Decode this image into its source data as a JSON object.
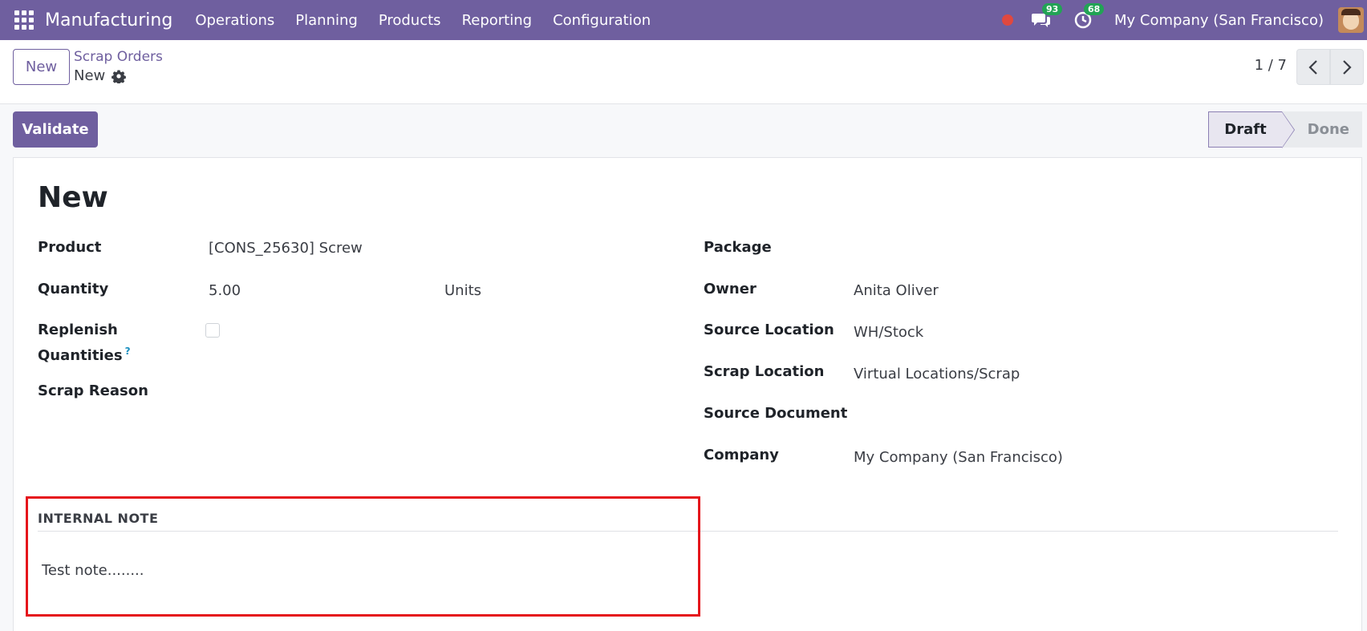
{
  "navbar": {
    "app_name": "Manufacturing",
    "menu": [
      "Operations",
      "Planning",
      "Products",
      "Reporting",
      "Configuration"
    ],
    "messages_count": "93",
    "activities_count": "68",
    "company": "My Company (San Francisco)",
    "accent_color": "#6f5f9f"
  },
  "control_panel": {
    "new_button": "New",
    "breadcrumb_parent": "Scrap Orders",
    "breadcrumb_current": "New",
    "pager": "1 / 7"
  },
  "statusbar": {
    "validate_button": "Validate",
    "stages": [
      "Draft",
      "Done"
    ],
    "active_stage": "Draft"
  },
  "form": {
    "title": "New",
    "left": {
      "product_label": "Product",
      "product_value": "[CONS_25630] Screw",
      "quantity_label": "Quantity",
      "quantity_value": "5.00",
      "uom_value": "Units",
      "replenish_label_1": "Replenish",
      "replenish_label_2": "Quantities",
      "replenish_help": "?",
      "replenish_checked": false,
      "scrap_reason_label": "Scrap Reason"
    },
    "right": {
      "package_label": "Package",
      "owner_label": "Owner",
      "owner_value": "Anita Oliver",
      "source_location_label": "Source Location",
      "source_location_value": "WH/Stock",
      "scrap_location_label": "Scrap Location",
      "scrap_location_value": "Virtual Locations/Scrap",
      "source_document_label": "Source Document",
      "company_label": "Company",
      "company_value": "My Company (San Francisco)"
    },
    "internal_note": {
      "title": "INTERNAL NOTE",
      "text": "Test note........"
    }
  }
}
